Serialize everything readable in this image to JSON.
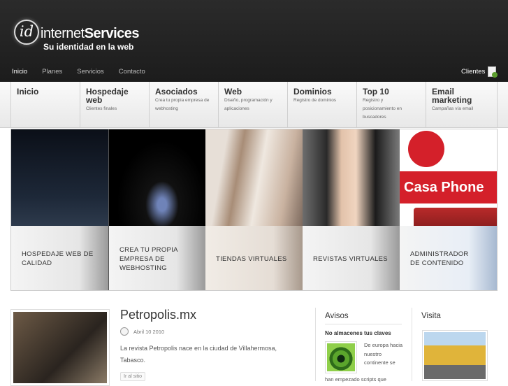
{
  "brand": {
    "logo_mark": "id",
    "logo_prefix": "internet",
    "logo_suffix": "Services",
    "tagline": "Su identidad en la web"
  },
  "topnav": {
    "items": [
      "Inicio",
      "Planes",
      "Servicios",
      "Contacto"
    ],
    "clients_label": "Clientes"
  },
  "menu": [
    {
      "title": "Inicio",
      "sub": ""
    },
    {
      "title": "Hospedaje web",
      "sub": "Clientes finales"
    },
    {
      "title": "Asociados",
      "sub": "Crea tu propia empresa de webhosting"
    },
    {
      "title": "Web",
      "sub": "Diseño, programación y aplicaciones"
    },
    {
      "title": "Dominios",
      "sub": "Registro de dominios"
    },
    {
      "title": "Top 10",
      "sub": "Registro y posicionamiento en buscadores"
    },
    {
      "title": "Email marketing",
      "sub": "Campañas vía email"
    }
  ],
  "slider": {
    "panels": [
      {
        "caption": "HOSPEDAJE WEB DE CALIDAD"
      },
      {
        "caption": "CREA TU PROPIA EMPRESA DE WEBHOSTING"
      },
      {
        "caption": "TIENDAS VIRTUALES"
      },
      {
        "caption": "REVISTAS VIRTUALES"
      },
      {
        "caption": "ADMINISTRADOR DE CONTENIDO",
        "image_text": "Casa Phone"
      }
    ]
  },
  "post": {
    "title": "Petropolis.mx",
    "date": "Abril 10 2010",
    "body": "La revista Petropolis nace en la ciudad de Villahermosa, Tabasco.",
    "read_more": "Ir al sitio"
  },
  "avisos": {
    "title": "Avisos",
    "headline": "No almacenes tus claves",
    "text": "De europa hacia nuestro continente se",
    "text_more": "han empezado scripts que"
  },
  "visita": {
    "title": "Visita"
  },
  "colors": {
    "header_bg": "#222222",
    "menu_bg": "#efefef",
    "casa_phone_red": "#d4202a"
  }
}
